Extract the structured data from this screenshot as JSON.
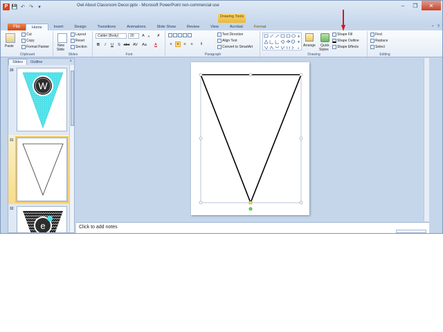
{
  "window": {
    "title": "Owl About Classroom Decor.pptx - Microsoft PowerPoint non-commercial use",
    "app_icon_letter": "P",
    "contextual_tab_group": "Drawing Tools"
  },
  "tabs": {
    "file": "File",
    "items": [
      "Home",
      "Insert",
      "Design",
      "Transitions",
      "Animations",
      "Slide Show",
      "Review",
      "View",
      "Acrobat",
      "Format"
    ]
  },
  "ribbon": {
    "clipboard": {
      "paste": "Paste",
      "cut": "Cut",
      "copy": "Copy",
      "format_painter": "Format Painter",
      "label": "Clipboard"
    },
    "slides": {
      "new_slide": "New",
      "new_slide_2": "Slide",
      "layout": "Layout",
      "reset": "Reset",
      "section": "Section",
      "label": "Slides"
    },
    "font": {
      "font_name": "Calibri (Body)",
      "font_size": "20",
      "grow": "A",
      "shrink": "A",
      "bold": "B",
      "italic": "I",
      "underline": "U",
      "strike": "S",
      "shadow": "abc",
      "spacing": "AV",
      "case": "Aa",
      "color": "A",
      "label": "Font"
    },
    "paragraph": {
      "text_direction": "Text Direction",
      "align_text": "Align Text",
      "smartart": "Convert to SmartArt",
      "label": "Paragraph"
    },
    "drawing": {
      "arrange": "Arrange",
      "quick_styles": "Quick",
      "quick_styles_2": "Styles",
      "shape_fill": "Shape Fill",
      "shape_outline": "Shape Outline",
      "shape_effects": "Shape Effects",
      "label": "Drawing"
    },
    "editing": {
      "find": "Find",
      "replace": "Replace",
      "select": "Select",
      "label": "Editing"
    }
  },
  "slides_panel": {
    "tab_slides": "Slides",
    "tab_outline": "Outline",
    "close": "×",
    "thumbnails": [
      {
        "number": "30",
        "letter": "W",
        "color": "#4fe0e8"
      },
      {
        "number": "31",
        "letter": "",
        "color": "#ffffff"
      },
      {
        "number": "32",
        "letter": "e",
        "color": "#222222"
      }
    ]
  },
  "notes": {
    "placeholder": "Click to add notes"
  },
  "colors": {
    "accent_arrow": "#e0121b",
    "selection": "#f9dc86",
    "file_tab": "#d24726"
  }
}
